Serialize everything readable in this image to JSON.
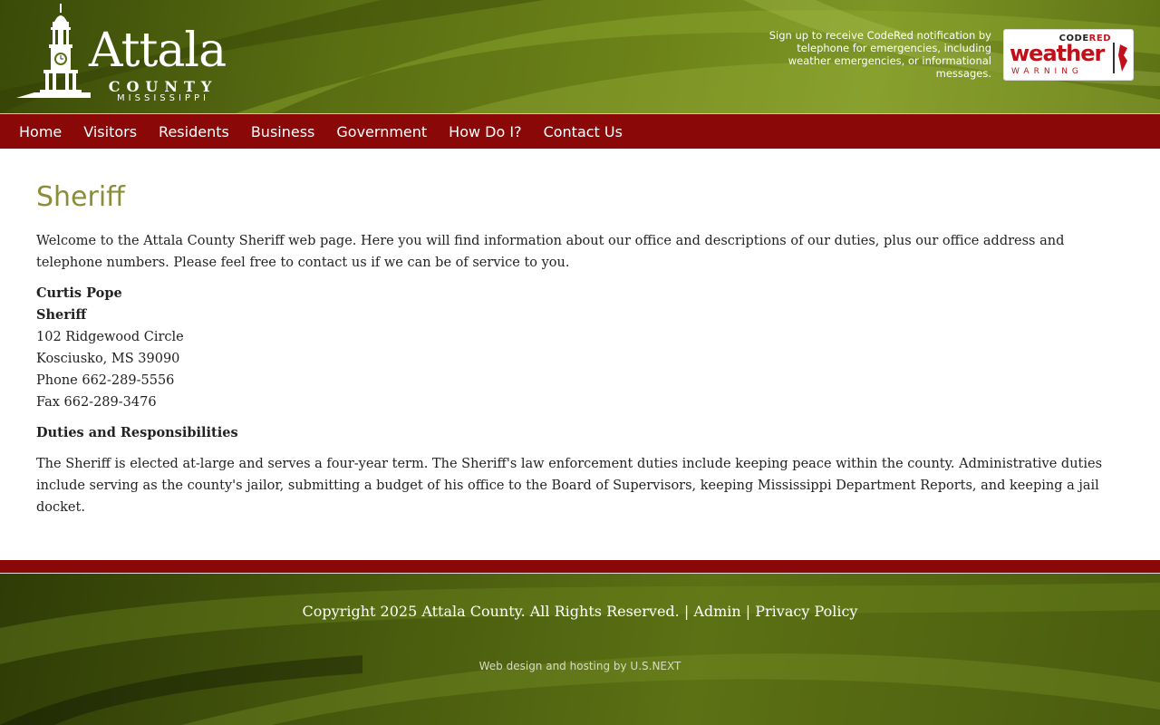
{
  "header": {
    "logo": {
      "title": "Attala",
      "county": "COUNTY",
      "state": "MISSISSIPPI"
    },
    "codered": {
      "text": "Sign up to receive CodeRed notification by telephone for emergencies, including weather emergencies, or informational messages.",
      "badge_code": "CODE",
      "badge_red": "RED",
      "badge_weather": "weather",
      "badge_warning": "WARNING"
    }
  },
  "nav": {
    "items": [
      {
        "label": "Home"
      },
      {
        "label": "Visitors"
      },
      {
        "label": "Residents"
      },
      {
        "label": "Business"
      },
      {
        "label": "Government"
      },
      {
        "label": "How Do I?"
      },
      {
        "label": "Contact Us"
      }
    ]
  },
  "main": {
    "title": "Sheriff",
    "intro": "Welcome to the Attala County Sheriff web page.  Here you will find information about our office and descriptions of our duties, plus our office address and telephone numbers.  Please feel free to contact us if we can be of service to you.",
    "contact": {
      "name": "Curtis Pope",
      "role": "Sheriff",
      "address1": "102 Ridgewood Circle",
      "address2": "Kosciusko, MS 39090",
      "phone": "Phone  662-289-5556",
      "fax": "Fax  662-289-3476"
    },
    "duties_heading": "Duties and Responsibilities",
    "duties_text": "The Sheriff is elected at-large and serves a four-year term.  The Sheriff's law enforcement duties include keeping peace within the county.  Administrative duties include serving as the county's jailor, submitting a budget of his office to the Board of Supervisors, keeping Mississippi Department Reports, and keeping a jail docket."
  },
  "footer": {
    "copyright": "Copyright 2025 Attala County. All Rights Reserved.",
    "sep1": " | ",
    "admin": "Admin",
    "sep2": " | ",
    "privacy": "Privacy Policy",
    "credit": "Web design and hosting by U.S.NEXT"
  },
  "colors": {
    "nav_bg": "#8b0808",
    "title": "#8a8d3a",
    "header_green": "#5a6e12"
  }
}
